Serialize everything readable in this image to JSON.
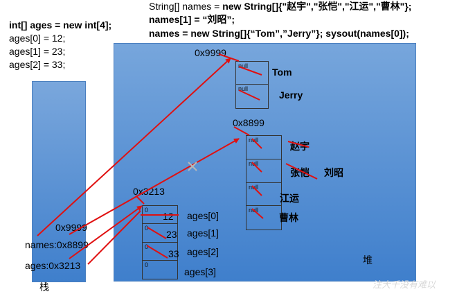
{
  "code_left": {
    "line1": "int[] ages = new int[4];",
    "line2": "ages[0] = 12;",
    "line3": "ages[1] = 23;",
    "line4": "ages[2] = 33;"
  },
  "code_top": {
    "line1_prefix": "String[] names = ",
    "line1_bold": "new String[]{\"赵宇\",\"张恺\",\"江运\",\"曹林\"};",
    "line2": "names[1] = “刘昭”;",
    "line3": "names = new String[]{“Tom”,”Jerry”}; sysout(names[0]);"
  },
  "stack": {
    "label": "栈",
    "var_new_addr": "0x9999",
    "var_names": "names:0x8899",
    "var_ages": "ages:0x3213"
  },
  "heap": {
    "label": "堆",
    "array_tom_jerry": {
      "address": "0x9999",
      "cells": [
        {
          "value": "null",
          "label": "Tom"
        },
        {
          "value": "null",
          "label": "Jerry"
        }
      ]
    },
    "array_names": {
      "address": "0x8899",
      "cells": [
        {
          "value": "null",
          "label": "赵宇"
        },
        {
          "value": "null",
          "label": "张恺"
        },
        {
          "value": "null",
          "label": "江运"
        },
        {
          "value": "null",
          "label": "曹林"
        }
      ],
      "replacement": "刘昭"
    },
    "array_ages": {
      "address": "0x3213",
      "cells": [
        {
          "value": "0",
          "new_value": "12",
          "label": "ages[0]"
        },
        {
          "value": "0",
          "new_value": "23",
          "label": "ages[1]"
        },
        {
          "value": "0",
          "new_value": "33",
          "label": "ages[2]"
        },
        {
          "value": "0",
          "new_value": "",
          "label": "ages[3]"
        }
      ]
    }
  },
  "watermark": "注大千没有难以",
  "colors": {
    "box_top": "#7aa7dc",
    "box_bottom": "#3f7fcc",
    "arrow": "#e01010",
    "cross_mark": "#b8b8b8"
  }
}
